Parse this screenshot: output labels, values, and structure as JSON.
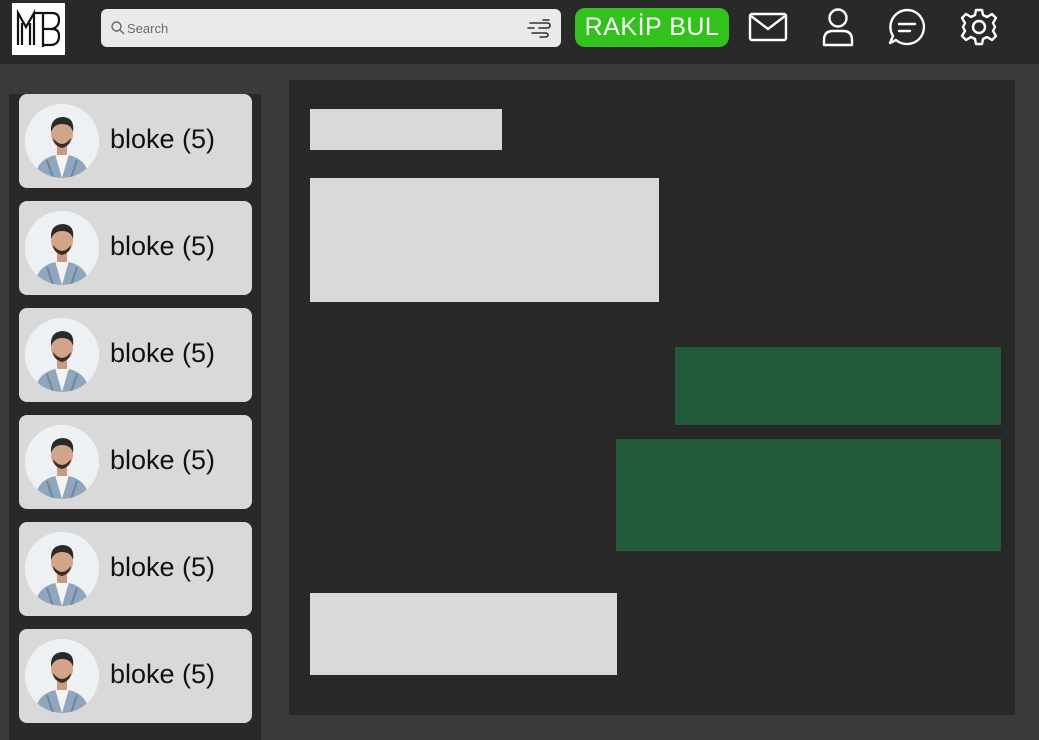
{
  "app": {
    "logo_text": "MTB"
  },
  "search": {
    "placeholder": "Search"
  },
  "header": {
    "find_opponent_label": "RAKİP BUL"
  },
  "icons": {
    "mail": "mail-icon",
    "profile": "user-icon",
    "chat": "chat-icon",
    "settings": "gear-icon",
    "search": "search-icon",
    "filter": "filter-icon"
  },
  "colors": {
    "topbar": "#292929",
    "background": "#3a3a3a",
    "accent": "#33c21d",
    "incoming_bubble": "#d9d9d9",
    "outgoing_bubble": "#235a3a",
    "contact_card": "#d9d9d9"
  },
  "contacts": [
    {
      "name": "bloke (5)"
    },
    {
      "name": "bloke (5)"
    },
    {
      "name": "bloke (5)"
    },
    {
      "name": "bloke (5)"
    },
    {
      "name": "bloke (5)"
    },
    {
      "name": "bloke (5)"
    }
  ],
  "messages": [
    {
      "direction": "incoming",
      "text": ""
    },
    {
      "direction": "incoming",
      "text": ""
    },
    {
      "direction": "outgoing",
      "text": ""
    },
    {
      "direction": "outgoing",
      "text": ""
    },
    {
      "direction": "incoming",
      "text": ""
    }
  ]
}
